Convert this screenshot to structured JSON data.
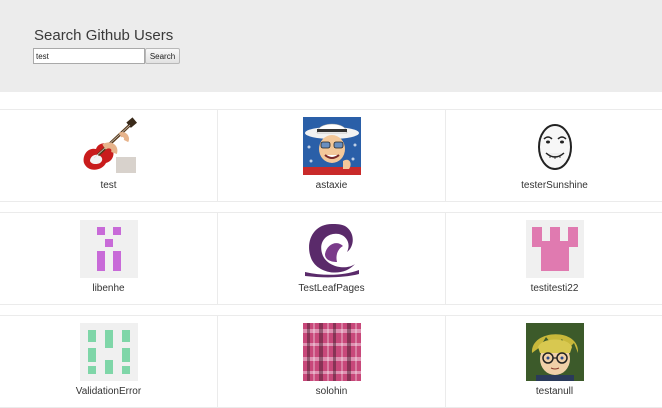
{
  "header": {
    "title": "Search Github Users",
    "search_value": "test",
    "search_button_label": "Search"
  },
  "users": [
    {
      "login": "test",
      "avatar": "guitar-photo"
    },
    {
      "login": "astaxie",
      "avatar": "cowboy-cartoon"
    },
    {
      "login": "testerSunshine",
      "avatar": "meme-face"
    },
    {
      "login": "libenhe",
      "avatar": "identicon-purple"
    },
    {
      "login": "TestLeafPages",
      "avatar": "leaf-logo"
    },
    {
      "login": "testitesti22",
      "avatar": "identicon-pink"
    },
    {
      "login": "ValidationError",
      "avatar": "identicon-green"
    },
    {
      "login": "solohin",
      "avatar": "plaid-pattern"
    },
    {
      "login": "testanull",
      "avatar": "anime-character"
    }
  ]
}
